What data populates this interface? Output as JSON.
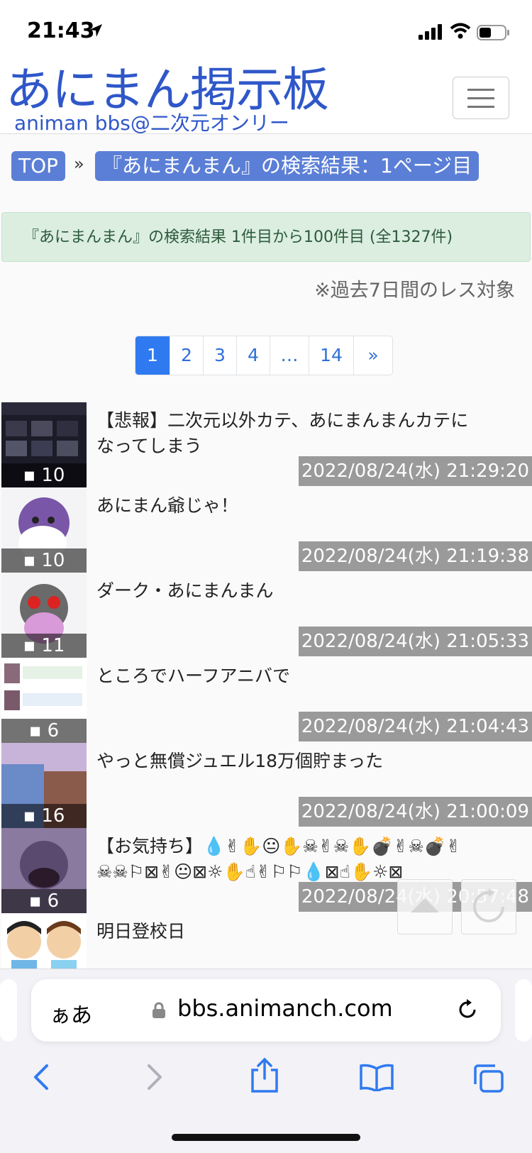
{
  "status_bar": {
    "time": "21:43"
  },
  "header": {
    "logo": "あにまん掲示板",
    "subtitle": "animan bbs@二次元オンリー"
  },
  "breadcrumb": {
    "top": "TOP",
    "separator": "»",
    "current": "『あにまんまん』の検索結果：1ページ目"
  },
  "alert": "『あにまんまん』の検索結果 1件目から100件目 (全1327件)",
  "note": "※過去7日間のレス対象",
  "pagination": {
    "pages": [
      "1",
      "2",
      "3",
      "4",
      "…",
      "14",
      "»"
    ],
    "active": "1"
  },
  "threads": [
    {
      "title": "【悲報】二次元以外カテ、あにまんまんカテになってしまう",
      "count": "10",
      "timestamp": "2022/08/24(水) 21:29:20"
    },
    {
      "title": "あにまん爺じゃ！",
      "count": "10",
      "timestamp": "2022/08/24(水) 21:19:38"
    },
    {
      "title": "ダーク・あにまんまん",
      "count": "11",
      "timestamp": "2022/08/24(水) 21:05:33"
    },
    {
      "title": "ところでハーフアニバで",
      "count": "6",
      "timestamp": "2022/08/24(水) 21:04:43"
    },
    {
      "title": "やっと無償ジュエル18万個貯まった",
      "count": "16",
      "timestamp": "2022/08/24(水) 21:00:09"
    },
    {
      "title": "【お気持ち】💧✌✋😐✋☠✌☠✋💣✌☠💣✌☠☠⚐⊠✌😐⊠☼✋☝✌⚐⚐💧⊠☝✋☼⊠",
      "count": "6",
      "timestamp": "2022/08/24(水) 20:57:48"
    },
    {
      "title": "明日登校日",
      "count": "",
      "timestamp": ""
    }
  ],
  "browser": {
    "aa_label": "ぁあ",
    "url": "bbs.animanch.com"
  },
  "colors": {
    "brand": "#2f57c9",
    "badge": "#5b7fd6",
    "active_page": "#2f7af0"
  }
}
